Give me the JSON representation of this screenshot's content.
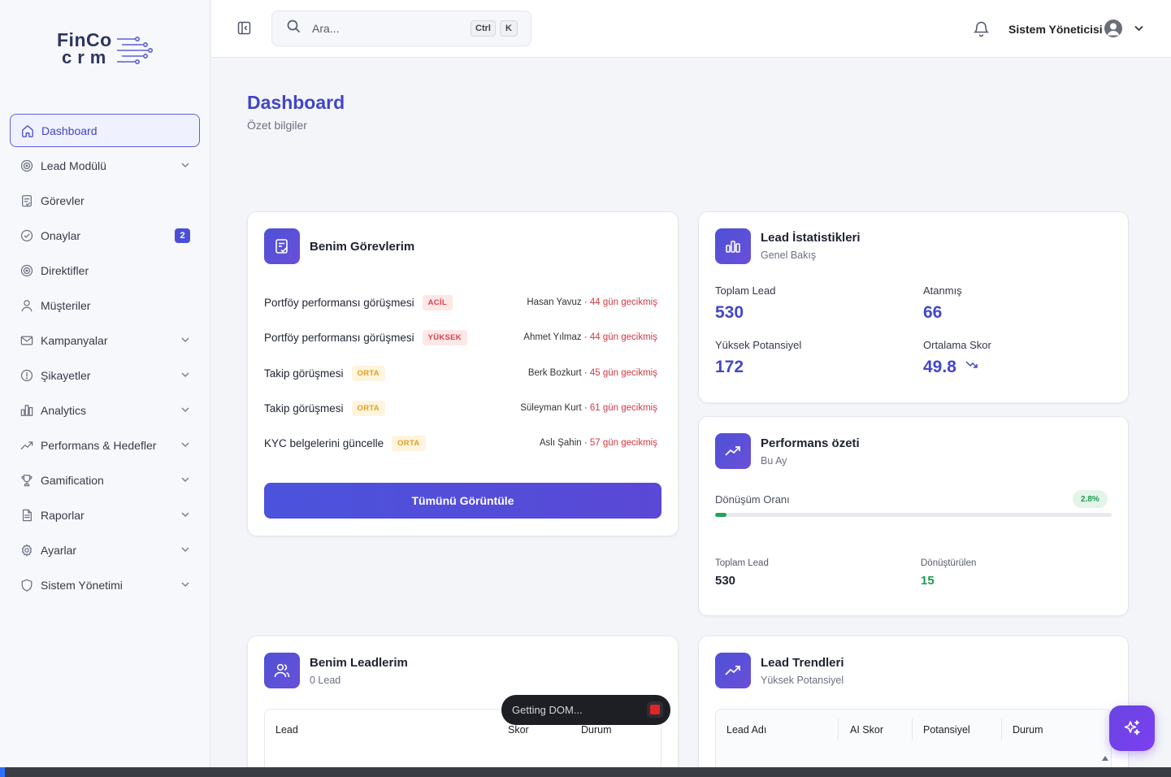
{
  "logo": {
    "line1": "FinCo",
    "line2": "crm"
  },
  "sidebar": {
    "items": [
      {
        "label": "Dashboard",
        "icon": "home-icon",
        "active": true
      },
      {
        "label": "Lead Modülü",
        "icon": "target-icon",
        "chevron": true
      },
      {
        "label": "Görevler",
        "icon": "clipboard-icon"
      },
      {
        "label": "Onaylar",
        "icon": "check-circle-icon",
        "badge": "2"
      },
      {
        "label": "Direktifler",
        "icon": "target-icon"
      },
      {
        "label": "Müşteriler",
        "icon": "user-icon"
      },
      {
        "label": "Kampanyalar",
        "icon": "mail-icon",
        "chevron": true
      },
      {
        "label": "Şikayetler",
        "icon": "alert-circle-icon",
        "chevron": true
      },
      {
        "label": "Analytics",
        "icon": "bar-chart-icon",
        "chevron": true
      },
      {
        "label": "Performans & Hedefler",
        "icon": "trend-icon",
        "chevron": true
      },
      {
        "label": "Gamification",
        "icon": "trophy-icon",
        "chevron": true
      },
      {
        "label": "Raporlar",
        "icon": "file-icon",
        "chevron": true
      },
      {
        "label": "Ayarlar",
        "icon": "gear-icon",
        "chevron": true
      },
      {
        "label": "Sistem Yönetimi",
        "icon": "shield-icon",
        "chevron": true
      }
    ]
  },
  "topbar": {
    "search_placeholder": "Ara...",
    "kbd1": "Ctrl",
    "kbd2": "K",
    "user_name": "Sistem Yöneticisi"
  },
  "page": {
    "title": "Dashboard",
    "subtitle": "Özet bilgiler"
  },
  "tasks": {
    "title": "Benim Görevlerim",
    "items": [
      {
        "title": "Portföy performansı görüşmesi",
        "priority": "ACİL",
        "prio_class": "acil",
        "person": "Hasan Yavuz",
        "late": "44 gün gecikmiş"
      },
      {
        "title": "Portföy performansı görüşmesi",
        "priority": "YÜKSEK",
        "prio_class": "yuksek",
        "person": "Ahmet Yılmaz",
        "late": "44 gün gecikmiş"
      },
      {
        "title": "Takip görüşmesi",
        "priority": "ORTA",
        "prio_class": "orta",
        "person": "Berk Bozkurt",
        "late": "45 gün gecikmiş"
      },
      {
        "title": "Takip görüşmesi",
        "priority": "ORTA",
        "prio_class": "orta",
        "person": "Süleyman Kurt",
        "late": "61 gün gecikmiş"
      },
      {
        "title": "KYC belgelerini güncelle",
        "priority": "ORTA",
        "prio_class": "orta",
        "person": "Aslı Şahin",
        "late": "57 gün gecikmiş"
      }
    ],
    "button": "Tümünü Görüntüle"
  },
  "lead_stats": {
    "title": "Lead İstatistikleri",
    "subtitle": "Genel Bakış",
    "total_label": "Toplam Lead",
    "total_value": "530",
    "assigned_label": "Atanmış",
    "assigned_value": "66",
    "high_label": "Yüksek Potansiyel",
    "high_value": "172",
    "avg_label": "Ortalama Skor",
    "avg_value": "49.8"
  },
  "performance": {
    "title": "Performans özeti",
    "subtitle": "Bu Ay",
    "conversion_label": "Dönüşüm Oranı",
    "conversion_value": "2.8%",
    "conversion_fraction": 0.028,
    "total_label": "Toplam Lead",
    "total_value": "530",
    "converted_label": "Dönüştürülen",
    "converted_value": "15"
  },
  "my_leads": {
    "title": "Benim Leadlerim",
    "subtitle": "0 Lead",
    "columns": [
      "Lead",
      "Skor",
      "Durum"
    ]
  },
  "lead_trends": {
    "title": "Lead Trendleri",
    "subtitle": "Yüksek Potansiyel",
    "columns": [
      "Lead Adı",
      "AI Skor",
      "Potansiyel",
      "Durum"
    ]
  },
  "overlay": {
    "getting_dom": "Getting DOM..."
  },
  "colors": {
    "accent": "#4b4fd8",
    "success": "#22a356",
    "danger": "#d23846",
    "warning": "#e0a11f"
  }
}
